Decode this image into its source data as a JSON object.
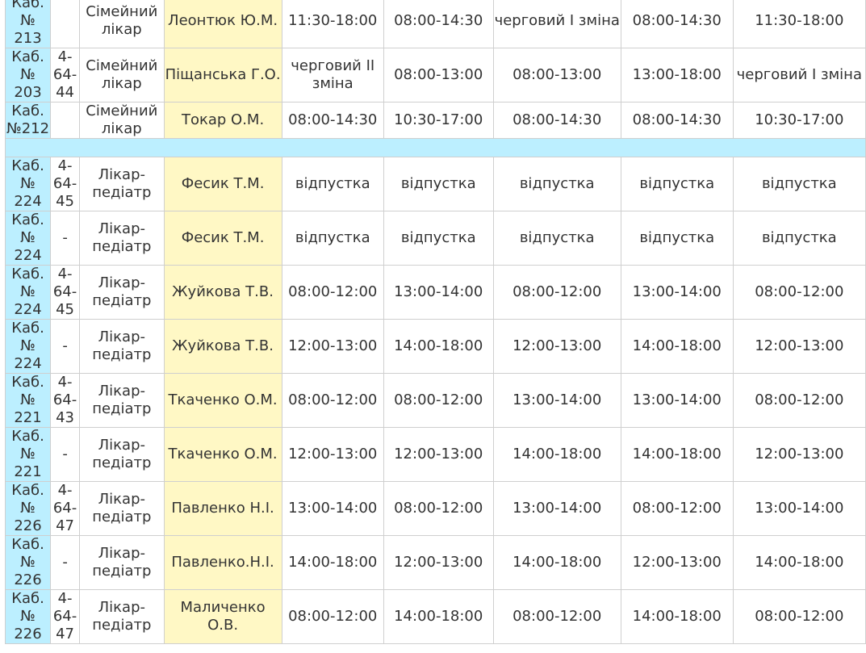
{
  "colors": {
    "cabinet_cell_bg": "#bcefff",
    "doctor_cell_bg": "#fff8c5",
    "separator_bg": "#bcefff",
    "border": "#cfcfcf",
    "text": "#333333"
  },
  "rows": [
    {
      "cabinet": [
        "Каб.",
        "№",
        "213"
      ],
      "phone": [],
      "specialty": [
        "Сімейний",
        "лікар"
      ],
      "doctor": [
        "Леонтюк Ю.М."
      ],
      "schedule": [
        "11:30-18:00",
        "08:00-14:30",
        "черговий І зміна",
        "08:00-14:30",
        "11:30-18:00"
      ]
    },
    {
      "cabinet": [
        "Каб.",
        "№",
        "203"
      ],
      "phone": [
        "4-",
        "64-",
        "44"
      ],
      "specialty": [
        "Сімейний",
        "лікар"
      ],
      "doctor": [
        "Піщанська Г.О."
      ],
      "schedule": [
        "черговий ІІ зміна",
        "08:00-13:00",
        "08:00-13:00",
        "13:00-18:00",
        "черговий І зміна"
      ]
    },
    {
      "cabinet": [
        "Каб.",
        "№212"
      ],
      "phone": [],
      "specialty": [
        "Сімейний",
        "лікар"
      ],
      "doctor": [
        "Токар О.М."
      ],
      "schedule": [
        "08:00-14:30",
        "10:30-17:00",
        "08:00-14:30",
        "08:00-14:30",
        "10:30-17:00"
      ]
    },
    {
      "separator": true
    },
    {
      "cabinet": [
        "Каб.",
        "№",
        "224"
      ],
      "phone": [
        "4-",
        "64-",
        "45"
      ],
      "specialty": [
        "Лікар-",
        "педіатр"
      ],
      "doctor": [
        "Фесик Т.М."
      ],
      "schedule": [
        "відпустка",
        "відпустка",
        "відпустка",
        "відпустка",
        "відпустка"
      ]
    },
    {
      "cabinet": [
        "Каб.",
        "№",
        "224"
      ],
      "phone": [
        "-"
      ],
      "specialty": [
        "Лікар-",
        "педіатр"
      ],
      "doctor": [
        "Фесик Т.М."
      ],
      "schedule": [
        "відпустка",
        "відпустка",
        "відпустка",
        "відпустка",
        "відпустка"
      ]
    },
    {
      "cabinet": [
        "Каб.",
        "№",
        "224"
      ],
      "phone": [
        "4-",
        "64-",
        "45"
      ],
      "specialty": [
        "Лікар-",
        "педіатр"
      ],
      "doctor": [
        "Жуйкова Т.В."
      ],
      "schedule": [
        "08:00-12:00",
        "13:00-14:00",
        "08:00-12:00",
        "13:00-14:00",
        "08:00-12:00"
      ]
    },
    {
      "cabinet": [
        "Каб.",
        "№",
        "224"
      ],
      "phone": [
        "-"
      ],
      "specialty": [
        "Лікар-",
        "педіатр"
      ],
      "doctor": [
        "Жуйкова Т.В."
      ],
      "schedule": [
        "12:00-13:00",
        "14:00-18:00",
        "12:00-13:00",
        "14:00-18:00",
        "12:00-13:00"
      ]
    },
    {
      "cabinet": [
        "Каб.",
        "№",
        "221"
      ],
      "phone": [
        "4-",
        "64-",
        "43"
      ],
      "specialty": [
        "Лікар-",
        "педіатр"
      ],
      "doctor": [
        "Ткаченко О.М."
      ],
      "schedule": [
        "08:00-12:00",
        "08:00-12:00",
        "13:00-14:00",
        "13:00-14:00",
        "08:00-12:00"
      ]
    },
    {
      "cabinet": [
        "Каб.",
        "№",
        "221"
      ],
      "phone": [
        "-"
      ],
      "specialty": [
        "Лікар-",
        "педіатр"
      ],
      "doctor": [
        "Ткаченко О.М."
      ],
      "schedule": [
        "12:00-13:00",
        "12:00-13:00",
        "14:00-18:00",
        "14:00-18:00",
        "12:00-13:00"
      ]
    },
    {
      "cabinet": [
        "Каб.",
        "№",
        "226"
      ],
      "phone": [
        "4-",
        "64-",
        "47"
      ],
      "specialty": [
        "Лікар-",
        "педіатр"
      ],
      "doctor": [
        "Павленко Н.І."
      ],
      "schedule": [
        "13:00-14:00",
        "08:00-12:00",
        "13:00-14:00",
        "08:00-12:00",
        "13:00-14:00"
      ]
    },
    {
      "cabinet": [
        "Каб.",
        "№",
        "226"
      ],
      "phone": [
        "-"
      ],
      "specialty": [
        "Лікар-",
        "педіатр"
      ],
      "doctor": [
        "Павленко.Н.І."
      ],
      "schedule": [
        "14:00-18:00",
        "12:00-13:00",
        "14:00-18:00",
        "12:00-13:00",
        "14:00-18:00"
      ]
    },
    {
      "cabinet": [
        "Каб.",
        "№",
        "226"
      ],
      "phone": [
        "4-",
        "64-",
        "47"
      ],
      "specialty": [
        "Лікар-",
        "педіатр"
      ],
      "doctor": [
        "Маличенко",
        "О.В."
      ],
      "schedule": [
        "08:00-12:00",
        "14:00-18:00",
        "08:00-12:00",
        "14:00-18:00",
        "08:00-12:00"
      ]
    }
  ]
}
